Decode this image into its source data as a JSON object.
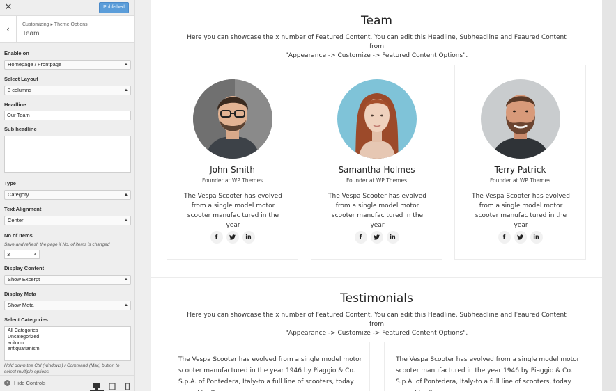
{
  "sidebar": {
    "close_icon": "close-icon",
    "publish_label": "Published",
    "breadcrumb": "Customizing ▸ Theme Options",
    "section_title": "Team",
    "fields": {
      "enable_on_label": "Enable on",
      "enable_on_value": "Homepage / Frontpage",
      "layout_label": "Select Layout",
      "layout_value": "3 columns",
      "headline_label": "Headline",
      "headline_value": "Our Team",
      "subheadline_label": "Sub headline",
      "subheadline_value": "",
      "type_label": "Type",
      "type_value": "Category",
      "alignment_label": "Text Alignment",
      "alignment_value": "Center",
      "items_label": "No of Items",
      "items_note": "Save and refresh the page if No. of items is changed",
      "items_value": "3",
      "display_content_label": "Display Content",
      "display_content_value": "Show Excerpt",
      "display_meta_label": "Display Meta",
      "display_meta_value": "Show Meta",
      "categories_label": "Select Categories",
      "categories_options": [
        "All Categories",
        "Uncategorized",
        "aciform",
        "antiquarianism"
      ],
      "categories_note": "Hold down the Ctrl (windows) / Command (Mac) button to select multiple options."
    },
    "footer": {
      "hide_controls_label": "Hide Controls",
      "active_device": "desktop"
    }
  },
  "preview": {
    "team": {
      "title": "Team",
      "description_line1": "Here you can showcase the x number of Featured Content. You can edit this Headline, Subheadline and Feaured Content from",
      "description_line2": "\"Appearance -> Customize -> Featured Content Options\".",
      "members": [
        {
          "name": "John Smith",
          "role": "Founder at WP Themes",
          "bio": "The Vespa Scooter has evolved from a single model motor scooter manufac tured in the year"
        },
        {
          "name": "Samantha Holmes",
          "role": "Founder at WP Themes",
          "bio": "The Vespa Scooter has evolved from a single model motor scooter manufac tured in the year"
        },
        {
          "name": "Terry Patrick",
          "role": "Founder at WP Themes",
          "bio": "The Vespa Scooter has evolved from a single model motor scooter manufac tured in the year"
        }
      ],
      "social": {
        "facebook": "f",
        "twitter": "🐦",
        "linkedin": "in"
      }
    },
    "testimonials": {
      "title": "Testimonials",
      "description_line1": "Here you can showcase the x number of Featured Content. You can edit this Headline, Subheadline and Feaured Content from",
      "description_line2": "\"Appearance -> Customize -> Featured Content Options\".",
      "items": [
        {
          "text": "The Vespa Scooter has evolved from a single model motor scooter manufactured in the year 1946 by Piaggio & Co. S.p.A. of Pontedera, Italy-to a full line of scooters, today owned by Piaggio."
        },
        {
          "text": "The Vespa Scooter has evolved from a single model motor scooter manufactured in the year 1946 by Piaggio & Co. S.p.A. of Pontedera, Italy-to a full line of scooters, today owned by Piaggio."
        }
      ]
    }
  },
  "colors": {
    "publish_button": "#5b9dd9",
    "sidebar_bg": "#eeeeee",
    "preview_bg": "#ffffff"
  }
}
